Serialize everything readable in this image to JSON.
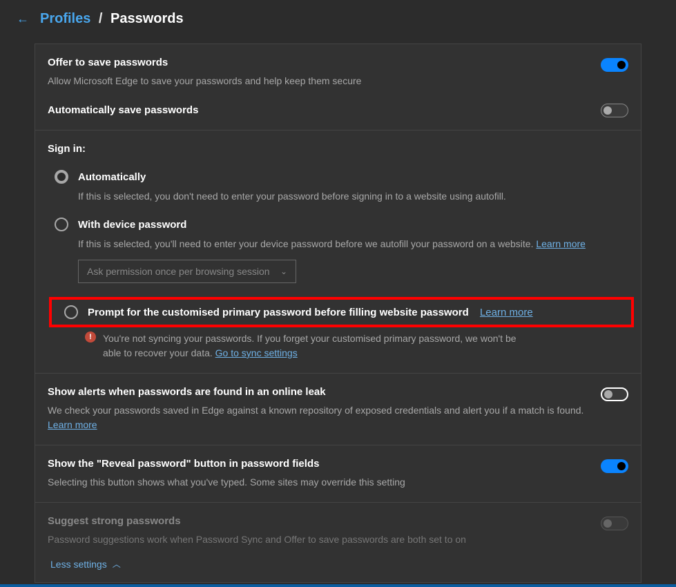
{
  "breadcrumb": {
    "parent": "Profiles",
    "sep": " / ",
    "current": "Passwords"
  },
  "offer": {
    "title": "Offer to save passwords",
    "desc": "Allow Microsoft Edge to save your passwords and help keep them secure"
  },
  "autosave": {
    "title": "Automatically save passwords"
  },
  "signin": {
    "title": "Sign in:",
    "auto": {
      "label": "Automatically",
      "desc": "If this is selected, you don't need to enter your password before signing in to a website using autofill."
    },
    "device": {
      "label": "With device password",
      "desc": "If this is selected, you'll need to enter your device password before we autofill your password on a website. ",
      "learn": "Learn more",
      "dropdown": "Ask permission once per browsing session"
    },
    "prompt": {
      "label": "Prompt for the customised primary password before filling website password",
      "learn": "Learn more",
      "warn": "You're not syncing your passwords. If you forget your customised primary password, we won't be able to recover your data. ",
      "sync": "Go to sync settings"
    }
  },
  "alerts": {
    "title": "Show alerts when passwords are found in an online leak",
    "desc": "We check your passwords saved in Edge against a known repository of exposed credentials and alert you if a match is found. ",
    "learn": "Learn more"
  },
  "reveal": {
    "title": "Show the \"Reveal password\" button in password fields",
    "desc": "Selecting this button shows what you've typed. Some sites may override this setting"
  },
  "suggest": {
    "title": "Suggest strong passwords",
    "desc": "Password suggestions work when Password Sync and Offer to save passwords are both set to on"
  },
  "less": "Less settings"
}
